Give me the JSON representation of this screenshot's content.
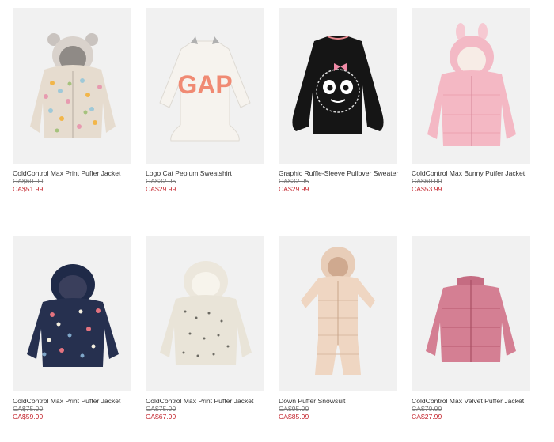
{
  "products": [
    {
      "name": "ColdControl Max Print Puffer Jacket",
      "was": "CA$60.00",
      "now": "CA$51.99",
      "image": "floral-hooded-puffer-ears"
    },
    {
      "name": "Logo Cat Peplum Sweatshirt",
      "was": "CA$32.95",
      "now": "CA$29.99",
      "image": "cream-gap-logo-sweatshirt"
    },
    {
      "name": "Graphic Ruffle-Sleeve Pullover Sweater",
      "was": "CA$32.95",
      "now": "CA$29.99",
      "image": "black-monster-face-sweater"
    },
    {
      "name": "ColdControl Max Bunny Puffer Jacket",
      "was": "CA$60.00",
      "now": "CA$53.99",
      "image": "pink-bunny-puffer"
    },
    {
      "name": "ColdControl Max Print Puffer Jacket",
      "was": "CA$75.00",
      "now": "CA$59.99",
      "image": "navy-floral-puffer"
    },
    {
      "name": "ColdControl Max Print Puffer Jacket",
      "was": "CA$75.00",
      "now": "CA$67.99",
      "image": "cream-print-sherpa-puffer"
    },
    {
      "name": "Down Puffer Snowsuit",
      "was": "CA$95.00",
      "now": "CA$85.99",
      "image": "champagne-snowsuit"
    },
    {
      "name": "ColdControl Max Velvet Puffer Jacket",
      "was": "CA$70.00",
      "now": "CA$27.99",
      "image": "pink-velvet-puffer"
    }
  ],
  "colors": {
    "sale_price": "#c4262e",
    "original_price": "#777777",
    "name": "#333333",
    "image_bg": "#f1f1f1"
  }
}
